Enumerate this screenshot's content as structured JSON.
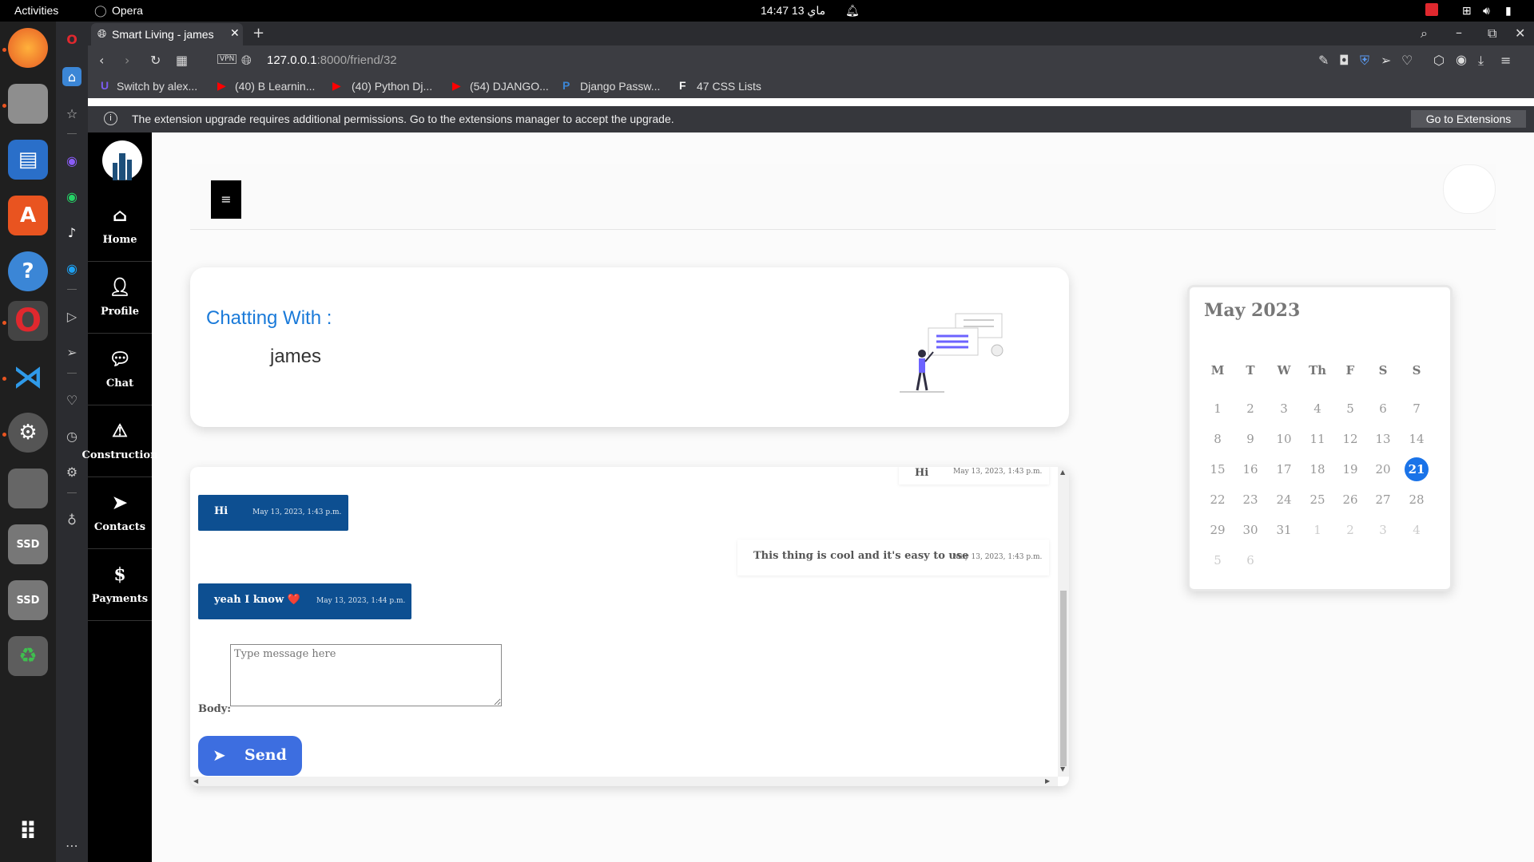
{
  "system": {
    "activities_label": "Activities",
    "app_name": "Opera",
    "clock": "14:47  13 ماي"
  },
  "browser": {
    "tab_title": "Smart Living - james",
    "url_host": "127.0.0.1",
    "url_path": ":8000/friend/32",
    "vpn_label": "VPN",
    "bookmarks": [
      {
        "label": "Switch by alex..."
      },
      {
        "label": "(40) B Learnin..."
      },
      {
        "label": "(40) Python Dj..."
      },
      {
        "label": "(54) DJANGO..."
      },
      {
        "label": "Django Passw..."
      },
      {
        "label": "47 CSS Lists"
      }
    ],
    "infobar_message": "The extension upgrade requires additional permissions. Go to the extensions manager to accept the upgrade.",
    "infobar_button": "Go to Extensions"
  },
  "sidebar": {
    "items": [
      {
        "label": "Home",
        "icon": "home-icon"
      },
      {
        "label": "Profile",
        "icon": "user-icon"
      },
      {
        "label": "Chat",
        "icon": "chat-icon"
      },
      {
        "label": "Construction",
        "icon": "warning-icon"
      },
      {
        "label": "Contacts",
        "icon": "paper-plane-icon"
      },
      {
        "label": "Payments",
        "icon": "dollar-icon"
      }
    ]
  },
  "chat_header": {
    "title": "Chatting With :",
    "friend": "james"
  },
  "messages": [
    {
      "side": "right",
      "text": "Hi",
      "time": "May 13, 2023, 1:43 p.m."
    },
    {
      "side": "left",
      "text": "Hi",
      "time": "May 13, 2023, 1:43 p.m."
    },
    {
      "side": "right",
      "text": "This thing is cool and it's easy to use",
      "time": "May 13, 2023, 1:43 p.m."
    },
    {
      "side": "left",
      "text": "yeah I know ❤️",
      "time": "May 13, 2023, 1:44 p.m."
    }
  ],
  "form": {
    "body_label": "Body:",
    "placeholder": "Type message here",
    "send_label": "Send"
  },
  "calendar": {
    "title": "May 2023",
    "weekdays": [
      "M",
      "T",
      "W",
      "Th",
      "F",
      "S",
      "S"
    ],
    "weeks": [
      [
        "1",
        "2",
        "3",
        "4",
        "5",
        "6",
        "7"
      ],
      [
        "8",
        "9",
        "10",
        "11",
        "12",
        "13",
        "14"
      ],
      [
        "15",
        "16",
        "17",
        "18",
        "19",
        "20",
        "21"
      ],
      [
        "22",
        "23",
        "24",
        "25",
        "26",
        "27",
        "28"
      ],
      [
        "29",
        "30",
        "31",
        "1",
        "2",
        "3",
        "4"
      ],
      [
        "5",
        "6"
      ]
    ],
    "today": "21",
    "accent": "#1a73e8"
  },
  "colors": {
    "message_left_bg": "#0d4f91",
    "send_button_bg": "#3d6ee0",
    "title_blue": "#1a7ad9"
  }
}
